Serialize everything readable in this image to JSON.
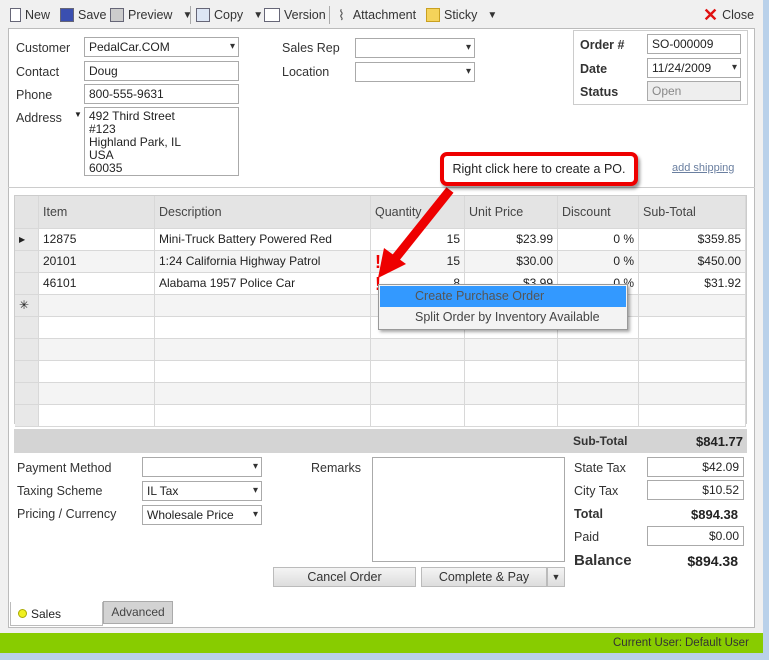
{
  "toolbar": {
    "new": "New",
    "save": "Save",
    "preview": "Preview",
    "copy": "Copy",
    "version": "Version",
    "attachment": "Attachment",
    "sticky": "Sticky",
    "close": "Close"
  },
  "header": {
    "customer_label": "Customer",
    "customer": "PedalCar.COM",
    "contact_label": "Contact",
    "contact": "Doug",
    "phone_label": "Phone",
    "phone": "800-555-9631",
    "address_label": "Address",
    "address": "492 Third Street\n#123\nHighland Park, IL\nUSA\n60035",
    "sales_rep_label": "Sales Rep",
    "sales_rep": "",
    "location_label": "Location",
    "location": "",
    "order_label": "Order #",
    "order": "SO-000009",
    "date_label": "Date",
    "date": "11/24/2009",
    "status_label": "Status",
    "status": "Open",
    "add_shipping": "add shipping"
  },
  "callout": "Right click here to create a PO.",
  "grid": {
    "columns": [
      "Item",
      "Description",
      "Quantity",
      "Unit Price",
      "Discount",
      "Sub-Total"
    ],
    "rows": [
      {
        "item": "12875",
        "description": "Mini-Truck Battery Powered Red",
        "quantity": "15",
        "unit_price": "$23.99",
        "discount": "0 %",
        "subtotal": "$359.85",
        "warning": false
      },
      {
        "item": "20101",
        "description": "1:24 California Highway Patrol",
        "quantity": "15",
        "unit_price": "$30.00",
        "discount": "0 %",
        "subtotal": "$450.00",
        "warning": true
      },
      {
        "item": "46101",
        "description": "Alabama 1957 Police Car",
        "quantity": "8",
        "unit_price": "$3.99",
        "discount": "0 %",
        "subtotal": "$31.92",
        "warning": true
      }
    ]
  },
  "context_menu": [
    "Create Purchase Order",
    "Split Order by Inventory Available"
  ],
  "totals": {
    "subtotal_label": "Sub-Total",
    "subtotal": "$841.77",
    "state_tax_label": "State Tax",
    "state_tax": "$42.09",
    "city_tax_label": "City Tax",
    "city_tax": "$10.52",
    "total_label": "Total",
    "total": "$894.38",
    "paid_label": "Paid",
    "paid": "$0.00",
    "balance_label": "Balance",
    "balance": "$894.38"
  },
  "footer_form": {
    "payment_label": "Payment Method",
    "payment": "",
    "taxing_label": "Taxing Scheme",
    "taxing": "IL Tax",
    "pricing_label": "Pricing / Currency",
    "pricing": "Wholesale Price",
    "remarks_label": "Remarks",
    "remarks": ""
  },
  "actions": {
    "cancel": "Cancel Order",
    "complete": "Complete & Pay"
  },
  "tabs": [
    "Sales",
    "Advanced"
  ],
  "statusbar": {
    "user_label": "Current User:",
    "user": "Default User"
  },
  "colors": {
    "status_green": "#88cc00",
    "menu_highlight": "#3399ff",
    "callout_red": "#ee0000"
  }
}
